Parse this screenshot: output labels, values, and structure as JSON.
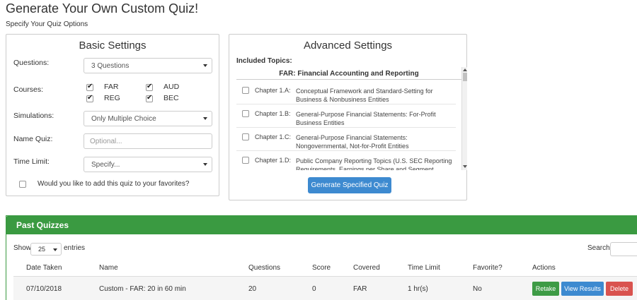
{
  "page": {
    "title": "Generate Your Own Custom Quiz!",
    "subtitle": "Specify Your Quiz Options"
  },
  "basic": {
    "heading": "Basic Settings",
    "questions_label": "Questions:",
    "questions_value": "3 Questions",
    "courses_label": "Courses:",
    "courses": [
      {
        "label": "FAR",
        "checked": true
      },
      {
        "label": "AUD",
        "checked": true
      },
      {
        "label": "REG",
        "checked": true
      },
      {
        "label": "BEC",
        "checked": true
      }
    ],
    "simulations_label": "Simulations:",
    "simulations_value": "Only Multiple Choice",
    "name_label": "Name Quiz:",
    "name_placeholder": "Optional...",
    "time_label": "Time Limit:",
    "time_value": "Specify...",
    "favorites_label": "Would you like to add this quiz to your favorites?"
  },
  "advanced": {
    "heading": "Advanced Settings",
    "included_label": "Included Topics:",
    "group_title": "FAR: Financial Accounting and Reporting",
    "topics": [
      {
        "chapter": "Chapter 1.A:",
        "title": "Conceptual Framework and Standard-Setting for Business & Nonbusiness Entities"
      },
      {
        "chapter": "Chapter 1.B:",
        "title": "General-Purpose Financial Statements: For-Profit Business Entities"
      },
      {
        "chapter": "Chapter 1.C:",
        "title": "General-Purpose Financial Statements: Nongovernmental, Not-for-Profit Entities"
      },
      {
        "chapter": "Chapter 1.D:",
        "title": "Public Company Reporting Topics (U.S. SEC Reporting Requirements, Earnings per Share and Segment Reporting)"
      }
    ],
    "generate_label": "Generate Specified Quiz"
  },
  "past": {
    "heading": "Past Quizzes",
    "show_label": "Show",
    "show_value": "25",
    "entries_label": "entries",
    "search_label": "Search:",
    "columns": [
      "Date Taken",
      "Name",
      "Questions",
      "Score",
      "Covered",
      "Time Limit",
      "Favorite?",
      "Actions"
    ],
    "rows": [
      {
        "date": "07/10/2018",
        "name": "Custom - FAR: 20 in 60 min",
        "questions": "20",
        "score": "0",
        "covered": "FAR",
        "time_limit": "1 hr(s)",
        "favorite": "No"
      }
    ],
    "actions": {
      "retake": "Retake",
      "view": "View Results",
      "delete": "Delete"
    }
  },
  "colors": {
    "primary": "#3d8ad0",
    "success": "#3a9a41",
    "danger": "#d9534f"
  }
}
